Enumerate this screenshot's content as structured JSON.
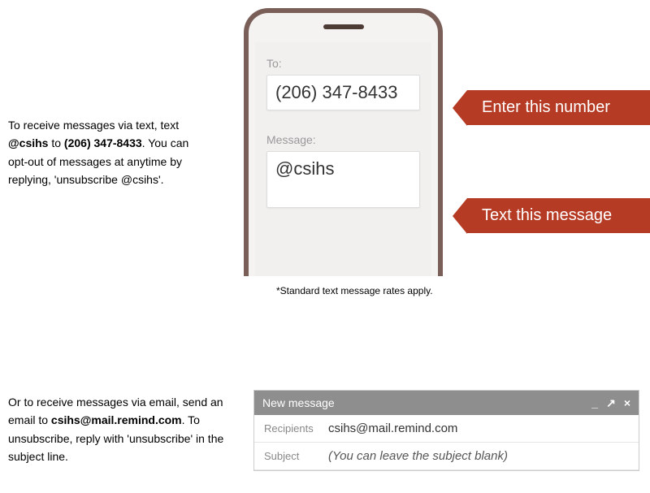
{
  "text_section": {
    "instructions_prefix": "To receive messages via text, text ",
    "code_bold": "@csihs",
    "instructions_mid": " to ",
    "phone_bold": "(206) 347-8433",
    "instructions_suffix": ". You can opt-out of messages at anytime by replying, 'unsubscribe @csihs'."
  },
  "phone": {
    "to_label": "To:",
    "to_value": "(206) 347-8433",
    "message_label": "Message:",
    "message_value": "@csihs"
  },
  "callouts": {
    "to": "Enter this number",
    "message": "Text this message"
  },
  "rates_note": "*Standard text message rates apply.",
  "email_section": {
    "instructions_prefix": "Or to receive messages via email, send an email to ",
    "email_bold": "csihs@mail.remind.com",
    "instructions_suffix": ". To unsubscribe, reply with 'unsubscribe' in the subject line."
  },
  "compose": {
    "title": "New message",
    "recipients_label": "Recipients",
    "recipients_value": "csihs@mail.remind.com",
    "subject_label": "Subject",
    "subject_placeholder": "(You can leave the subject blank)",
    "minimize": "_",
    "expand": "↗",
    "close": "×"
  }
}
